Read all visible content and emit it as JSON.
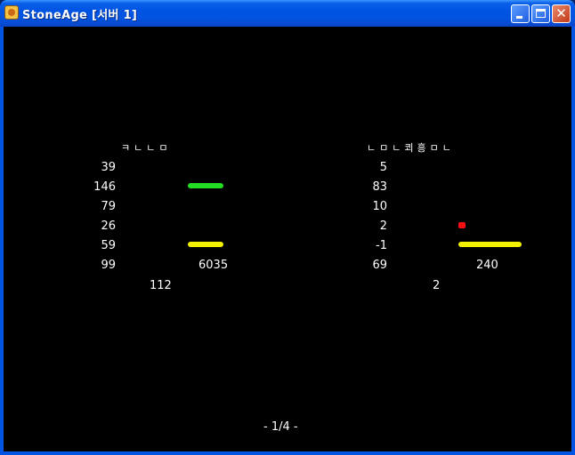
{
  "window": {
    "title": "StoneAge  [서버 1]",
    "minimize_icon": "minimize-icon",
    "maximize_icon": "maximize-icon",
    "close_icon": "close-icon",
    "close_glyph": "✕"
  },
  "left_panel": {
    "header": "ㅋㄴㄴㅁ",
    "stats": [
      "39",
      "146",
      "79",
      "26",
      "59",
      "99"
    ],
    "extra_value": "6035",
    "bottom_value": "112",
    "bars": [
      {
        "row": 2,
        "color": "#22dd22",
        "level": 1.0
      },
      {
        "row": 5,
        "color": "#f2f200",
        "level": 1.0
      }
    ]
  },
  "right_panel": {
    "header": "ㄴㅁㄴ쾨흥ㅁㄴ",
    "stats": [
      "5",
      "83",
      "10",
      "2",
      "-1",
      "69"
    ],
    "extra_value": "240",
    "bottom_value": "2",
    "indicators": [
      {
        "row": 4,
        "color": "#ff1010",
        "level": 0.0
      },
      {
        "row": 5,
        "color": "#f2f200",
        "level": 1.0
      }
    ]
  },
  "pagination": {
    "text": "- 1/4 -"
  }
}
